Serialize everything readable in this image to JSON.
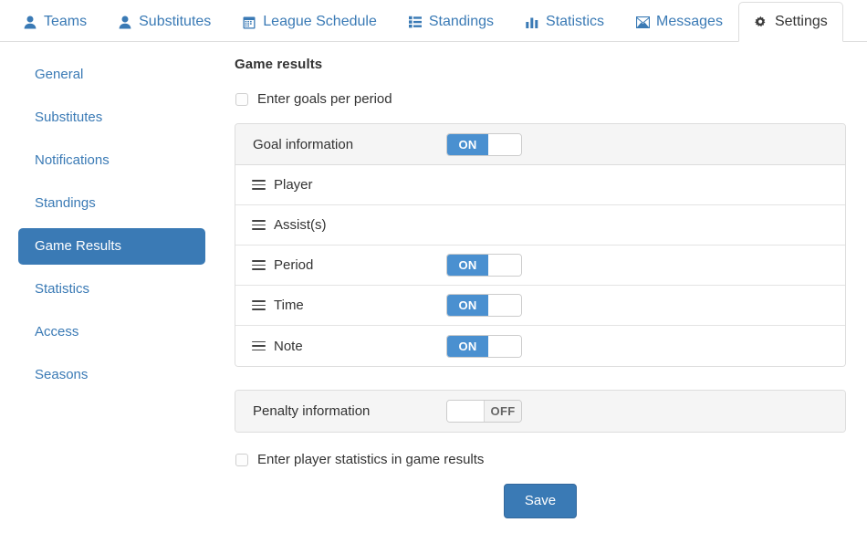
{
  "tabs": [
    {
      "label": "Teams",
      "icon": "user-icon",
      "active": false
    },
    {
      "label": "Substitutes",
      "icon": "user-icon",
      "active": false
    },
    {
      "label": "League Schedule",
      "icon": "calendar-icon",
      "active": false
    },
    {
      "label": "Standings",
      "icon": "list-icon",
      "active": false
    },
    {
      "label": "Statistics",
      "icon": "bar-chart-icon",
      "active": false
    },
    {
      "label": "Messages",
      "icon": "envelope-icon",
      "active": false
    },
    {
      "label": "Settings",
      "icon": "gear-icon",
      "active": true
    }
  ],
  "sidebar": {
    "items": [
      {
        "label": "General",
        "active": false
      },
      {
        "label": "Substitutes",
        "active": false
      },
      {
        "label": "Notifications",
        "active": false
      },
      {
        "label": "Standings",
        "active": false
      },
      {
        "label": "Game Results",
        "active": true
      },
      {
        "label": "Statistics",
        "active": false
      },
      {
        "label": "Access",
        "active": false
      },
      {
        "label": "Seasons",
        "active": false
      }
    ]
  },
  "main": {
    "section_title": "Game results",
    "goals_per_period_checkbox": {
      "label": "Enter goals per period",
      "checked": false
    },
    "goal_panel": {
      "title": "Goal information",
      "toggle": "ON",
      "rows": [
        {
          "label": "Player",
          "has_toggle": false,
          "toggle": ""
        },
        {
          "label": "Assist(s)",
          "has_toggle": false,
          "toggle": ""
        },
        {
          "label": "Period",
          "has_toggle": true,
          "toggle": "ON"
        },
        {
          "label": "Time",
          "has_toggle": true,
          "toggle": "ON"
        },
        {
          "label": "Note",
          "has_toggle": true,
          "toggle": "ON"
        }
      ]
    },
    "penalty_panel": {
      "title": "Penalty information",
      "toggle": "OFF"
    },
    "player_stats_checkbox": {
      "label": "Enter player statistics in game results",
      "checked": false
    },
    "save_label": "Save"
  },
  "colors": {
    "link_blue": "#3a7ab5",
    "toggle_blue": "#4a90d0",
    "panel_border": "#dddddd",
    "panel_head_bg": "#f5f5f5",
    "text": "#333333"
  }
}
